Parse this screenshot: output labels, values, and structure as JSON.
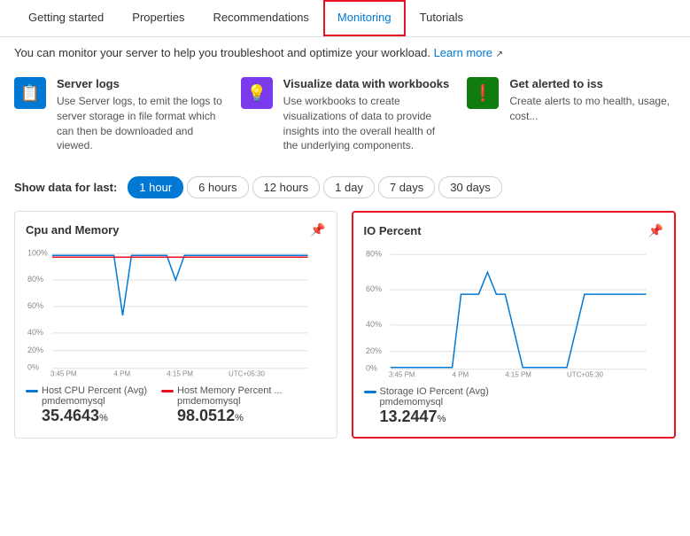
{
  "nav": {
    "items": [
      {
        "id": "getting-started",
        "label": "Getting started",
        "active": false
      },
      {
        "id": "properties",
        "label": "Properties",
        "active": false
      },
      {
        "id": "recommendations",
        "label": "Recommendations",
        "active": false
      },
      {
        "id": "monitoring",
        "label": "Monitoring",
        "active": true
      },
      {
        "id": "tutorials",
        "label": "Tutorials",
        "active": false
      }
    ]
  },
  "info_bar": {
    "text": "You can monitor your server to help you troubleshoot and optimize your workload.",
    "link_label": "Learn more"
  },
  "features": [
    {
      "id": "server-logs",
      "icon_type": "blue",
      "icon_symbol": "📋",
      "title": "Server logs",
      "description": "Use Server logs, to emit the logs to server storage in file format which can then be downloaded and viewed."
    },
    {
      "id": "workbooks",
      "icon_type": "purple",
      "icon_symbol": "💡",
      "title": "Visualize data with workbooks",
      "description": "Use workbooks to create visualizations of data to provide insights into the overall health of the underlying components."
    },
    {
      "id": "alerts",
      "icon_type": "green",
      "icon_symbol": "❗",
      "title": "Get alerted to iss",
      "description": "Create alerts to mo health, usage, cost..."
    }
  ],
  "time_selector": {
    "label": "Show data for last:",
    "options": [
      {
        "id": "1hour",
        "label": "1 hour",
        "active": true
      },
      {
        "id": "6hours",
        "label": "6 hours",
        "active": false
      },
      {
        "id": "12hours",
        "label": "12 hours",
        "active": false
      },
      {
        "id": "1day",
        "label": "1 day",
        "active": false
      },
      {
        "id": "7days",
        "label": "7 days",
        "active": false
      },
      {
        "id": "30days",
        "label": "30 days",
        "active": false
      }
    ]
  },
  "charts": [
    {
      "id": "cpu-memory",
      "title": "Cpu and Memory",
      "highlighted": false,
      "time_range": "3:45 PM ... 4:15 PM   UTC+05:30",
      "legend": [
        {
          "id": "cpu",
          "color": "#0078d4",
          "label": "Host CPU Percent (Avg)",
          "sublabel": "pmdemomysql",
          "value": "35.4643",
          "unit": "%"
        },
        {
          "id": "memory",
          "color": "#e81123",
          "label": "Host Memory Percent ...",
          "sublabel": "pmdemomysql",
          "value": "98.0512",
          "unit": "%"
        }
      ]
    },
    {
      "id": "io-percent",
      "title": "IO Percent",
      "highlighted": true,
      "time_range": "3:45 PM ... 4:15 PM   UTC+05:30",
      "legend": [
        {
          "id": "io",
          "color": "#0078d4",
          "label": "Storage IO Percent (Avg)",
          "sublabel": "pmdemomysql",
          "value": "13.2447",
          "unit": "%"
        }
      ]
    }
  ]
}
